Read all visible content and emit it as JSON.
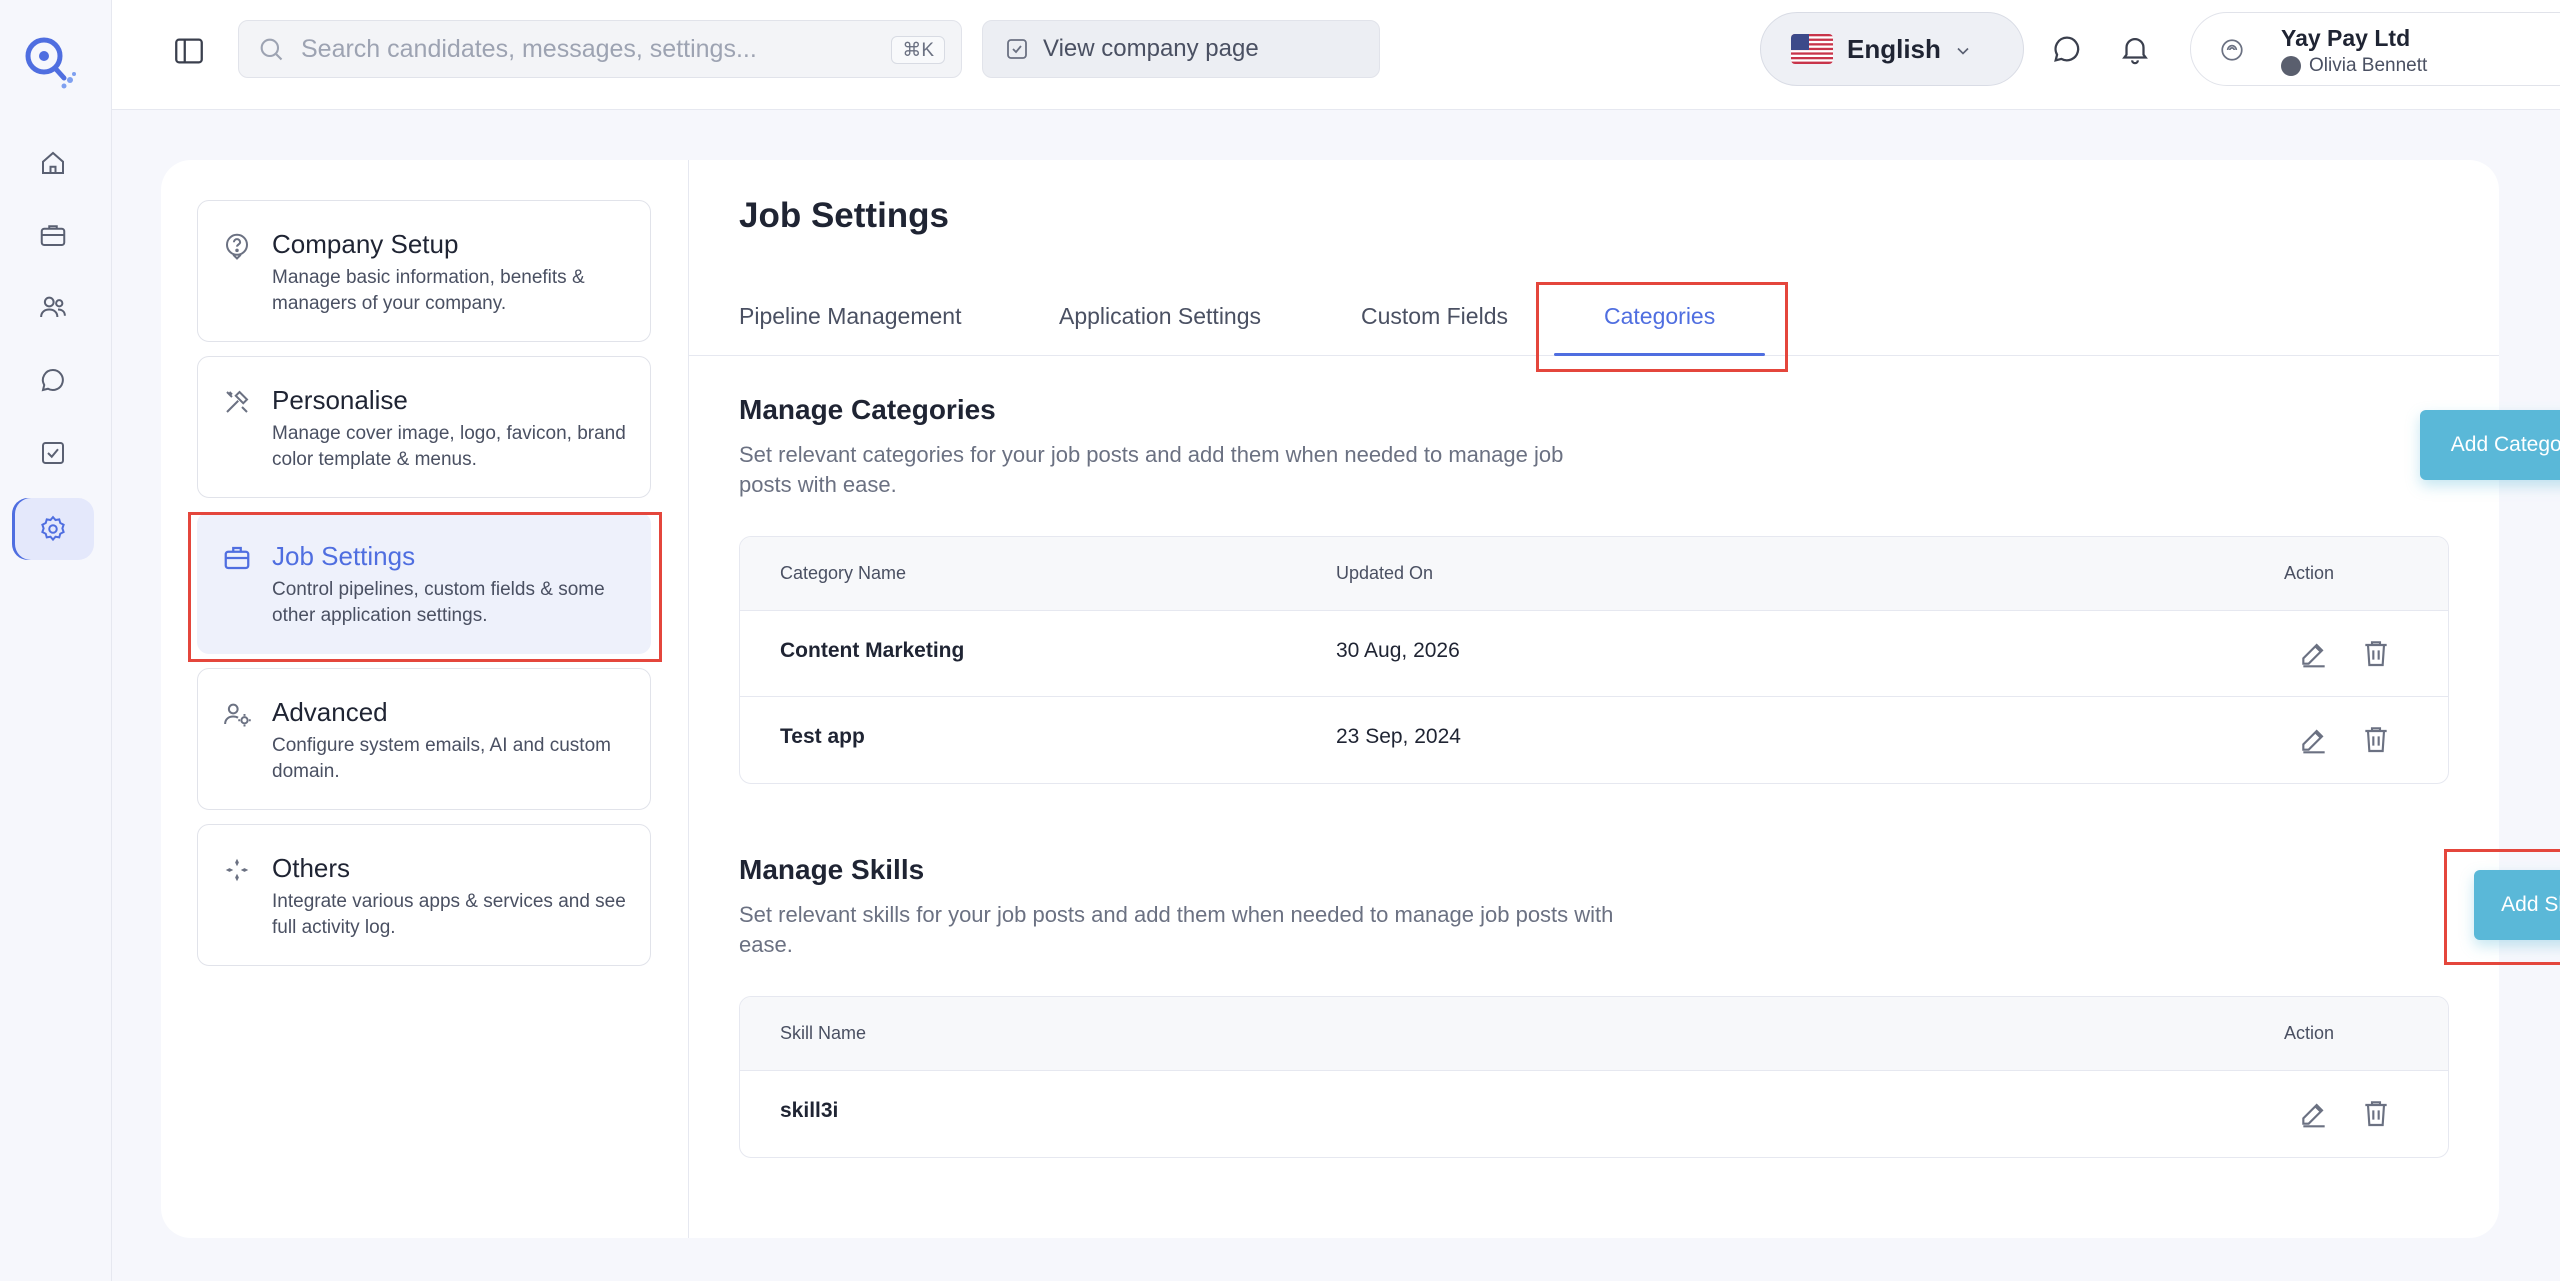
{
  "search": {
    "placeholder": "Search candidates, messages, settings...",
    "shortcut": "⌘K"
  },
  "header": {
    "view_company_label": "View company page",
    "language": "English",
    "company_name": "Yay Pay Ltd",
    "user_name": "Olivia Bennett"
  },
  "rail": [
    "home-icon",
    "briefcase-icon",
    "users-icon",
    "message-icon",
    "checklist-icon",
    "settings-icon"
  ],
  "settings_nav": [
    {
      "title": "Company Setup",
      "desc": "Manage basic information, benefits & managers of your company."
    },
    {
      "title": "Personalise",
      "desc": "Manage cover image, logo, favicon, brand color template & menus."
    },
    {
      "title": "Job Settings",
      "desc": "Control pipelines, custom fields & some other application settings."
    },
    {
      "title": "Advanced",
      "desc": "Configure system emails, AI and custom domain."
    },
    {
      "title": "Others",
      "desc": "Integrate various apps & services and see full activity log."
    }
  ],
  "page_title": "Job Settings",
  "tabs": [
    "Pipeline Management",
    "Application Settings",
    "Custom Fields",
    "Categories"
  ],
  "categories": {
    "title": "Manage Categories",
    "desc": "Set relevant categories for your job posts and add them when needed to manage job posts with ease.",
    "add_label": "Add Category",
    "columns": [
      "Category Name",
      "Updated On",
      "Action"
    ],
    "rows": [
      {
        "name": "Content Marketing",
        "updated": "30 Aug, 2026"
      },
      {
        "name": "Test app",
        "updated": "23 Sep, 2024"
      }
    ]
  },
  "skills": {
    "title": "Manage Skills",
    "desc": "Set relevant skills for your job posts and add them when needed to manage job posts with ease.",
    "add_label": "Add Skill",
    "columns": [
      "Skill Name",
      "Action"
    ],
    "rows": [
      {
        "name": "skill3i"
      }
    ]
  },
  "colors": {
    "accent": "#4f6ee0",
    "button": "#5ab8d8",
    "highlight": "#e4463c"
  }
}
